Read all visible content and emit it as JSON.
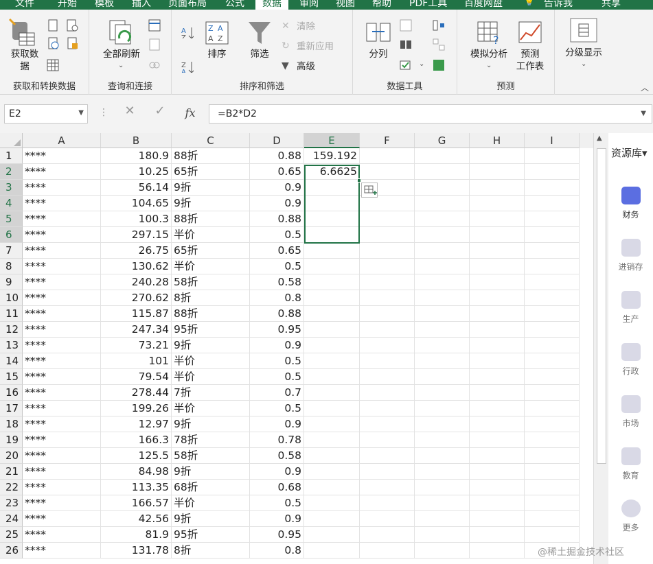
{
  "tabs": [
    "文件",
    "开始",
    "模板",
    "插入",
    "页面布局",
    "公式",
    "数据",
    "审阅",
    "视图",
    "帮助",
    "PDF工具",
    "百度网盘",
    "告诉我",
    "共享"
  ],
  "active_tab": "数据",
  "ribbon": {
    "groups": [
      {
        "label": "获取和转换数据",
        "buttons": [
          {
            "label": "获取数\n据"
          }
        ]
      },
      {
        "label": "查询和连接",
        "buttons": [
          {
            "label": "全部刷新"
          }
        ]
      },
      {
        "label": "排序和筛选",
        "buttons": [
          {
            "label": "排序"
          },
          {
            "label": "筛选"
          },
          {
            "label": "清除"
          },
          {
            "label": "重新应用"
          },
          {
            "label": "高级"
          }
        ]
      },
      {
        "label": "数据工具",
        "buttons": [
          {
            "label": "分列"
          }
        ]
      },
      {
        "label": "预测",
        "buttons": [
          {
            "label": "模拟分析"
          },
          {
            "label": "预测\n工作表"
          }
        ]
      },
      {
        "label": "",
        "buttons": [
          {
            "label": "分级显示"
          }
        ]
      }
    ]
  },
  "formula_bar": {
    "name_box": "E2",
    "formula": "=B2*D2",
    "fx": "fx"
  },
  "columns": [
    "A",
    "B",
    "C",
    "D",
    "E",
    "F",
    "G",
    "H",
    "I"
  ],
  "selected_column": "E",
  "rows": [
    {
      "n": "1",
      "a": "****",
      "b": "180.9",
      "c": "88折",
      "d": "0.88",
      "e": "159.192"
    },
    {
      "n": "2",
      "a": "****",
      "b": "10.25",
      "c": "65折",
      "d": "0.65",
      "e": "6.6625"
    },
    {
      "n": "3",
      "a": "****",
      "b": "56.14",
      "c": "9折",
      "d": "0.9",
      "e": ""
    },
    {
      "n": "4",
      "a": "****",
      "b": "104.65",
      "c": "9折",
      "d": "0.9",
      "e": ""
    },
    {
      "n": "5",
      "a": "****",
      "b": "100.3",
      "c": "88折",
      "d": "0.88",
      "e": ""
    },
    {
      "n": "6",
      "a": "****",
      "b": "297.15",
      "c": "半价",
      "d": "0.5",
      "e": ""
    },
    {
      "n": "7",
      "a": "****",
      "b": "26.75",
      "c": "65折",
      "d": "0.65",
      "e": ""
    },
    {
      "n": "8",
      "a": "****",
      "b": "130.62",
      "c": "半价",
      "d": "0.5",
      "e": ""
    },
    {
      "n": "9",
      "a": "****",
      "b": "240.28",
      "c": "58折",
      "d": "0.58",
      "e": ""
    },
    {
      "n": "10",
      "a": "****",
      "b": "270.62",
      "c": "8折",
      "d": "0.8",
      "e": ""
    },
    {
      "n": "11",
      "a": "****",
      "b": "115.87",
      "c": "88折",
      "d": "0.88",
      "e": ""
    },
    {
      "n": "12",
      "a": "****",
      "b": "247.34",
      "c": "95折",
      "d": "0.95",
      "e": ""
    },
    {
      "n": "13",
      "a": "****",
      "b": "73.21",
      "c": "9折",
      "d": "0.9",
      "e": ""
    },
    {
      "n": "14",
      "a": "****",
      "b": "101",
      "c": "半价",
      "d": "0.5",
      "e": ""
    },
    {
      "n": "15",
      "a": "****",
      "b": "79.54",
      "c": "半价",
      "d": "0.5",
      "e": ""
    },
    {
      "n": "16",
      "a": "****",
      "b": "278.44",
      "c": "7折",
      "d": "0.7",
      "e": ""
    },
    {
      "n": "17",
      "a": "****",
      "b": "199.26",
      "c": "半价",
      "d": "0.5",
      "e": ""
    },
    {
      "n": "18",
      "a": "****",
      "b": "12.97",
      "c": "9折",
      "d": "0.9",
      "e": ""
    },
    {
      "n": "19",
      "a": "****",
      "b": "166.3",
      "c": "78折",
      "d": "0.78",
      "e": ""
    },
    {
      "n": "20",
      "a": "****",
      "b": "125.5",
      "c": "58折",
      "d": "0.58",
      "e": ""
    },
    {
      "n": "21",
      "a": "****",
      "b": "84.98",
      "c": "9折",
      "d": "0.9",
      "e": ""
    },
    {
      "n": "22",
      "a": "****",
      "b": "113.35",
      "c": "68折",
      "d": "0.68",
      "e": ""
    },
    {
      "n": "23",
      "a": "****",
      "b": "166.57",
      "c": "半价",
      "d": "0.5",
      "e": ""
    },
    {
      "n": "24",
      "a": "****",
      "b": "42.56",
      "c": "9折",
      "d": "0.9",
      "e": ""
    },
    {
      "n": "25",
      "a": "****",
      "b": "81.9",
      "c": "95折",
      "d": "0.95",
      "e": ""
    },
    {
      "n": "26",
      "a": "****",
      "b": "131.78",
      "c": "8折",
      "d": "0.8",
      "e": ""
    }
  ],
  "resource_pane": {
    "title": "资源库▾",
    "items": [
      "财务",
      "进销存",
      "生产",
      "行政",
      "市场",
      "教育",
      "更多"
    ]
  },
  "watermark": "@稀土掘金技术社区"
}
